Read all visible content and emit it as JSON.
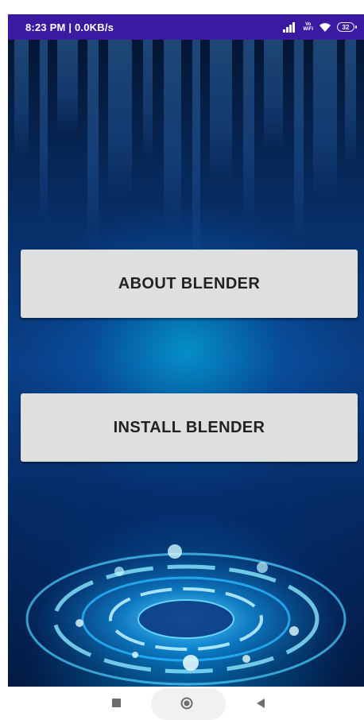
{
  "status_bar": {
    "time_speed": "8:23 PM | 0.0KB/s",
    "volte_line1": "Vo",
    "volte_line2": "WiFi",
    "battery_level": "32",
    "background_color": "#3a1aa0"
  },
  "main": {
    "buttons": [
      {
        "label": "ABOUT BLENDER"
      },
      {
        "label": "INSTALL BLENDER"
      }
    ],
    "button_color": "#dedfdf",
    "accent_color": "#00c8ff"
  },
  "nav_bar": {
    "recents_icon": "square-icon",
    "home_icon": "circle-icon",
    "back_icon": "triangle-back-icon"
  }
}
